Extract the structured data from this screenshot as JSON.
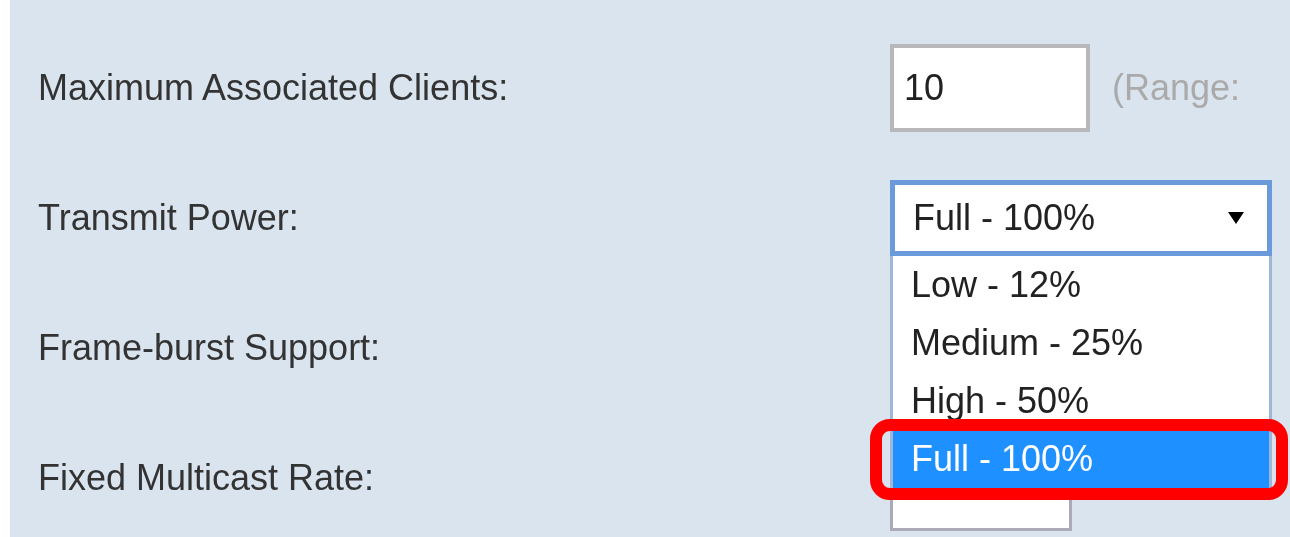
{
  "fields": [
    {
      "label": "Maximum Associated Clients:",
      "kind": "text",
      "value": "10",
      "hint": "(Range:"
    },
    {
      "label": "Transmit Power:",
      "kind": "select",
      "value": "Full - 100%",
      "expanded": true,
      "options": [
        {
          "label": "Low - 12%",
          "selected": false
        },
        {
          "label": "Medium - 25%",
          "selected": false
        },
        {
          "label": "High - 50%",
          "selected": false
        },
        {
          "label": "Full - 100%",
          "selected": true
        }
      ]
    },
    {
      "label": "Frame-burst Support:",
      "kind": "hidden"
    },
    {
      "label": "Fixed Multicast Rate:",
      "kind": "select-covered"
    }
  ]
}
